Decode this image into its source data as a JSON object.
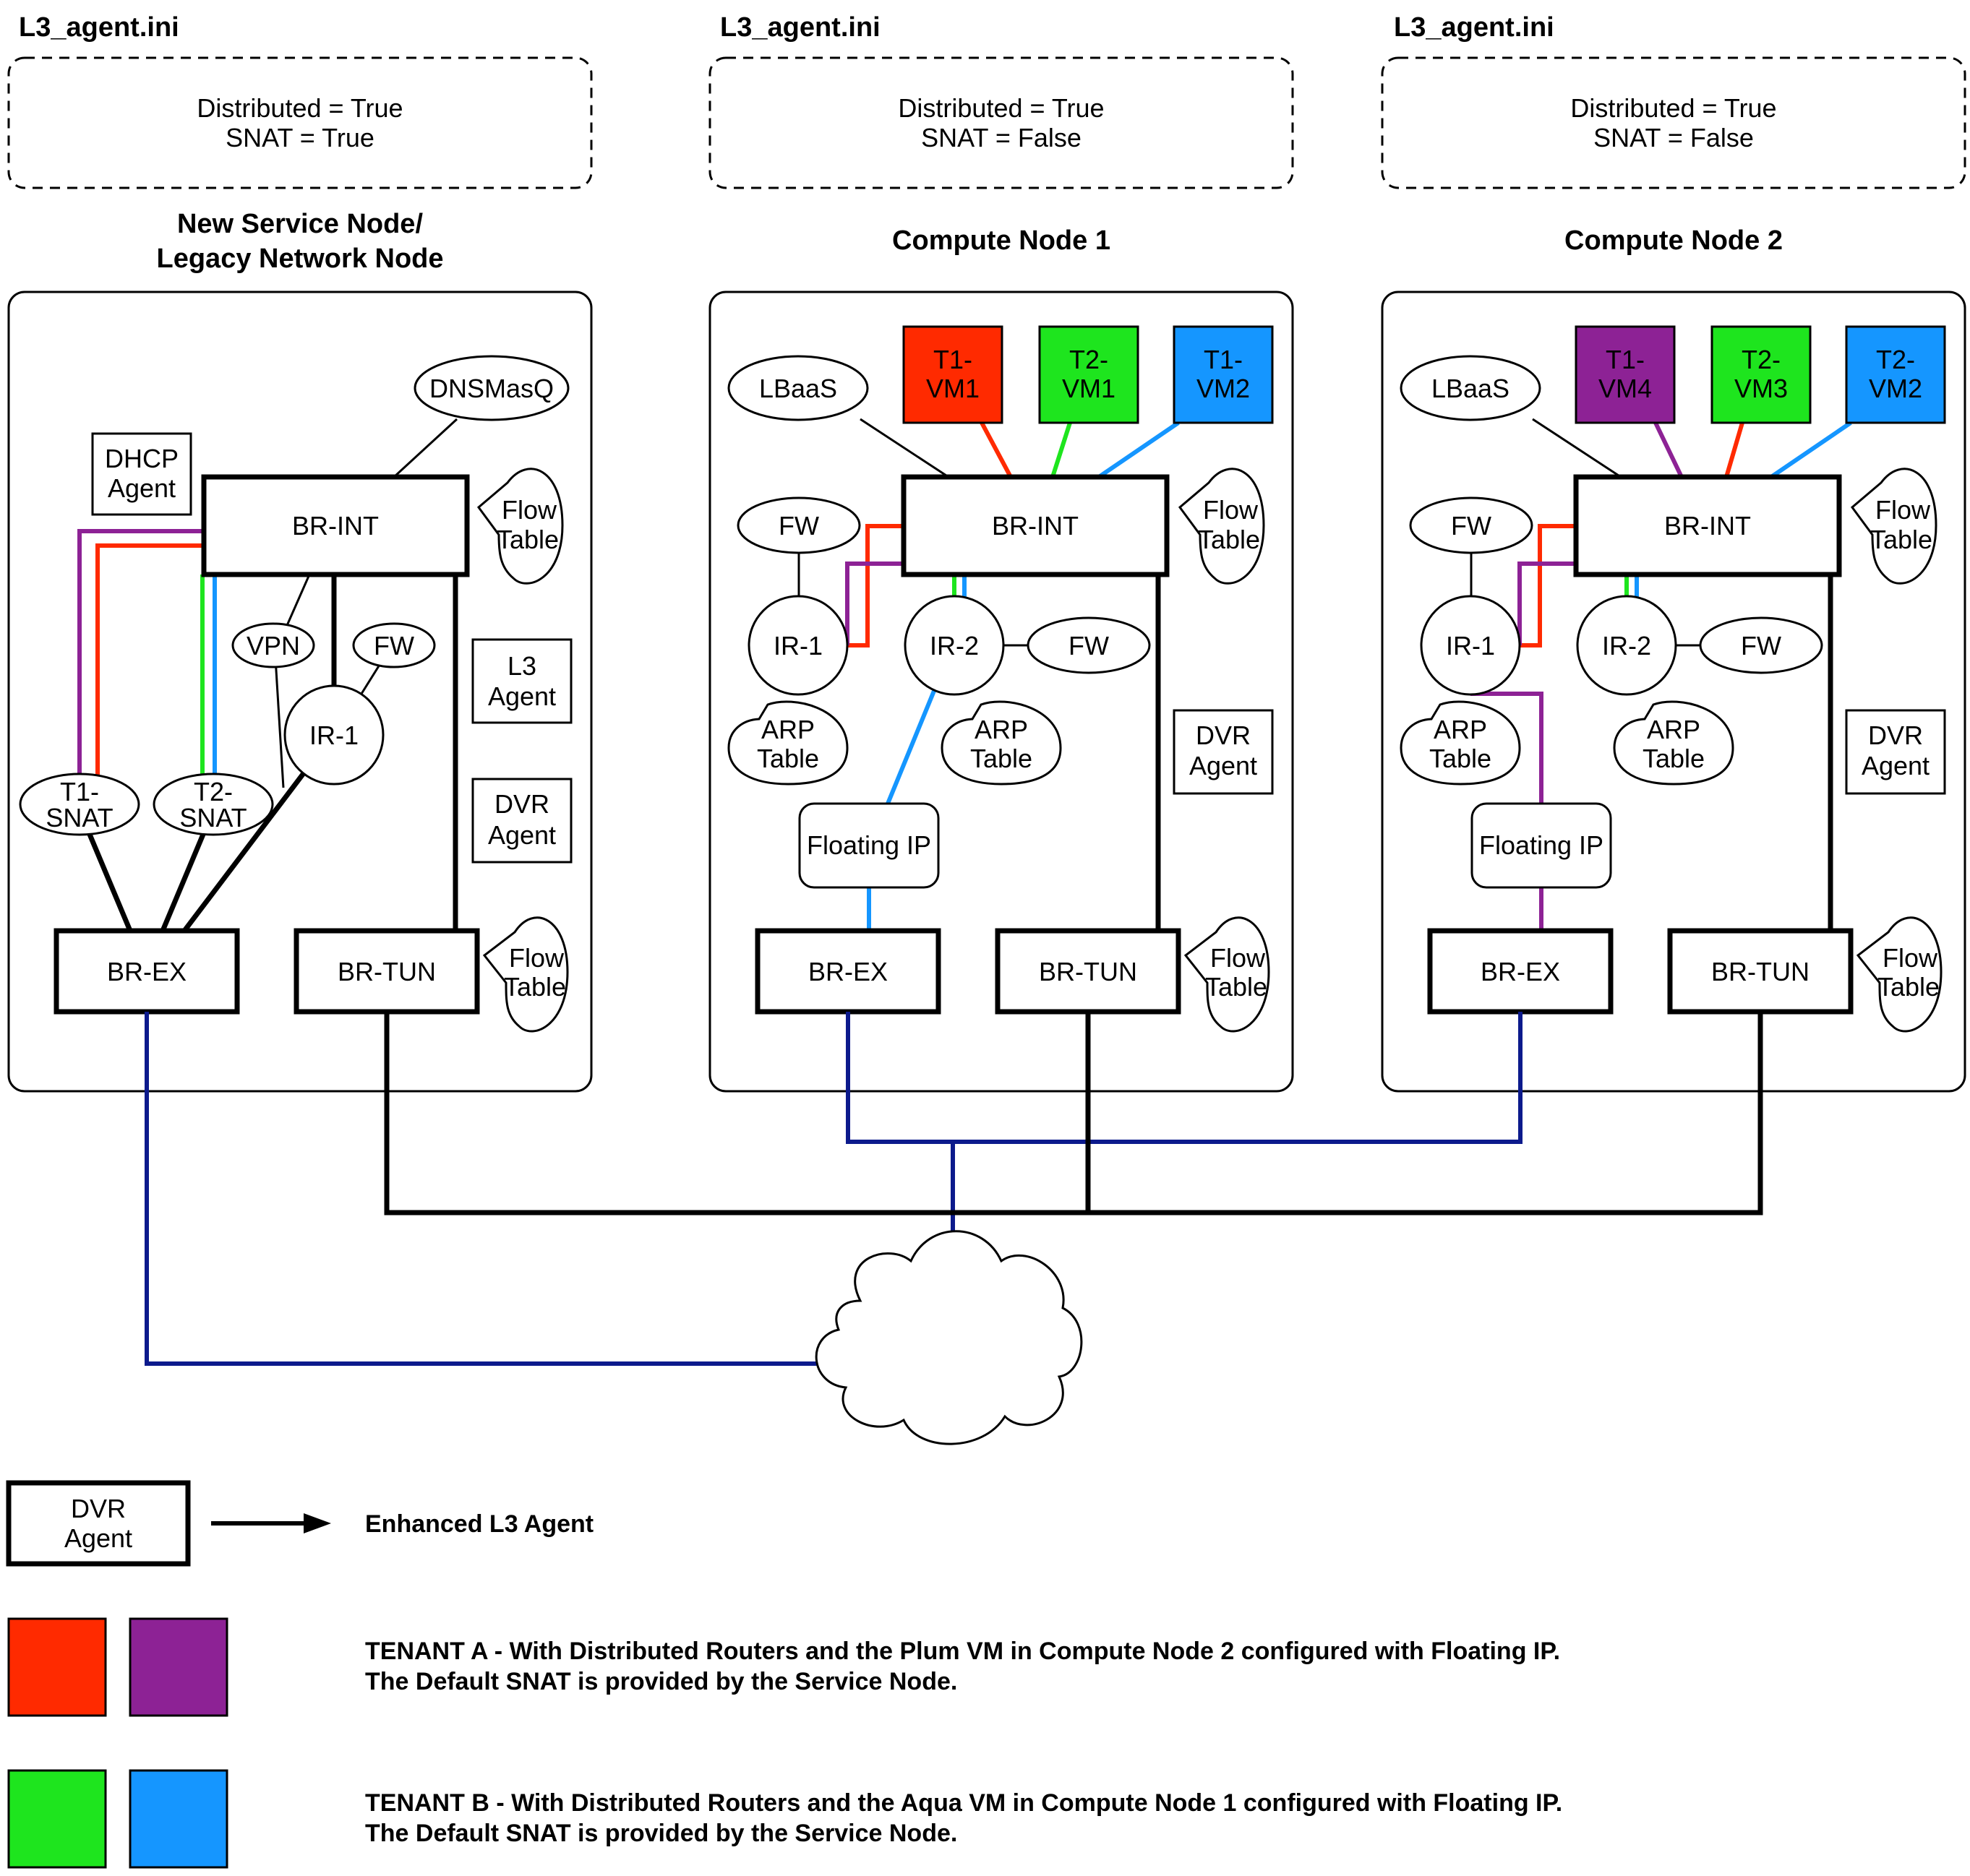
{
  "colors": {
    "red": "#ff2a00",
    "green": "#1ee51e",
    "blue": "#1596ff",
    "purple": "#8d2295",
    "navy": "#0c1a8c"
  },
  "nodes": [
    {
      "ini_title": "L3_agent.ini",
      "config": [
        "Distributed = True",
        "SNAT = True"
      ],
      "title": [
        "New Service Node/",
        "Legacy Network Node"
      ],
      "dnsmasq": "DNSMasQ",
      "dhcp_agent": [
        "DHCP",
        "Agent"
      ],
      "br_int": "BR-INT",
      "flow_table": [
        "Flow",
        "Table"
      ],
      "vpn": "VPN",
      "fw": "FW",
      "ir1": "IR-1",
      "l3_agent": [
        "L3",
        "Agent"
      ],
      "dvr_agent": [
        "DVR",
        "Agent"
      ],
      "t1_snat": [
        "T1-",
        "SNAT"
      ],
      "t2_snat": [
        "T2-",
        "SNAT"
      ],
      "br_ex": "BR-EX",
      "br_tun": "BR-TUN"
    },
    {
      "ini_title": "L3_agent.ini",
      "config": [
        "Distributed = True",
        "SNAT = False"
      ],
      "title": [
        "Compute Node 1"
      ],
      "lbaas": "LBaaS",
      "vms": [
        {
          "label": [
            "T1-",
            "VM1"
          ],
          "color": "red"
        },
        {
          "label": [
            "T2-",
            "VM1"
          ],
          "color": "green"
        },
        {
          "label": [
            "T1-",
            "VM2"
          ],
          "color": "blue"
        }
      ],
      "br_int": "BR-INT",
      "flow_table": [
        "Flow",
        "Table"
      ],
      "fw1": "FW",
      "ir1": "IR-1",
      "ir2": "IR-2",
      "fw2": "FW",
      "arp1": [
        "ARP",
        "Table"
      ],
      "arp2": [
        "ARP",
        "Table"
      ],
      "dvr_agent": [
        "DVR",
        "Agent"
      ],
      "floating_ip": "Floating IP",
      "br_ex": "BR-EX",
      "br_tun": "BR-TUN"
    },
    {
      "ini_title": "L3_agent.ini",
      "config": [
        "Distributed = True",
        "SNAT = False"
      ],
      "title": [
        "Compute Node 2"
      ],
      "lbaas": "LBaaS",
      "vms": [
        {
          "label": [
            "T1-",
            "VM4"
          ],
          "color": "purple"
        },
        {
          "label": [
            "T2-",
            "VM3"
          ],
          "color": "green"
        },
        {
          "label": [
            "T2-",
            "VM2"
          ],
          "color": "blue"
        }
      ],
      "br_int": "BR-INT",
      "flow_table": [
        "Flow",
        "Table"
      ],
      "fw1": "FW",
      "ir1": "IR-1",
      "ir2": "IR-2",
      "fw2": "FW",
      "arp1": [
        "ARP",
        "Table"
      ],
      "arp2": [
        "ARP",
        "Table"
      ],
      "dvr_agent": [
        "DVR",
        "Agent"
      ],
      "floating_ip": "Floating IP",
      "br_ex": "BR-EX",
      "br_tun": "BR-TUN"
    }
  ],
  "legend": {
    "dvr_box": [
      "DVR",
      "Agent"
    ],
    "arrow_label": "Enhanced L3 Agent",
    "tenant_a": [
      "TENANT A - With Distributed Routers and the Plum VM in Compute Node 2 configured with Floating IP.",
      "The Default SNAT is provided by the Service Node."
    ],
    "tenant_b": [
      "TENANT B - With Distributed Routers and the Aqua VM in Compute Node 1 configured with Floating IP.",
      "The Default SNAT is provided by the Service Node."
    ]
  }
}
